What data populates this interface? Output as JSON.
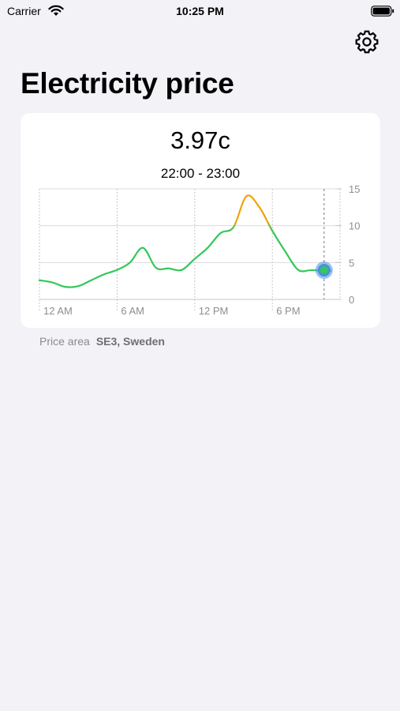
{
  "status_bar": {
    "carrier": "Carrier",
    "time": "10:25 PM",
    "icons": [
      "wifi-icon",
      "battery-icon"
    ]
  },
  "toolbar": {
    "settings_icon": "gear-icon"
  },
  "header": {
    "title": "Electricity price"
  },
  "card": {
    "price": "3.97c",
    "time_range": "22:00 - 23:00"
  },
  "footer": {
    "label": "Price area",
    "value": "SE3, Sweden"
  },
  "colors": {
    "background": "#f2f2f7",
    "low": "#34c759",
    "high": "#f0a30a",
    "selection": "#4a90e2"
  },
  "chart_data": {
    "type": "line",
    "x_unit": "hour",
    "x": [
      0,
      1,
      2,
      3,
      4,
      5,
      6,
      7,
      8,
      9,
      10,
      11,
      12,
      13,
      14,
      15,
      16,
      17,
      18,
      19,
      20,
      21,
      22,
      22.5
    ],
    "values": [
      2.6,
      2.3,
      1.7,
      1.8,
      2.6,
      3.4,
      4.0,
      5.0,
      7.0,
      4.3,
      4.2,
      4.0,
      5.5,
      7.0,
      9.0,
      9.8,
      14.0,
      12.5,
      9.3,
      6.5,
      4.0,
      3.97,
      3.9,
      3.9
    ],
    "x_tick_values": [
      0,
      6,
      12,
      18
    ],
    "x_tick_labels": [
      "12 AM",
      "6 AM",
      "12 PM",
      "6 PM"
    ],
    "y_ticks": [
      0,
      5,
      10,
      15
    ],
    "ylim": [
      0,
      15
    ],
    "xlim": [
      0,
      22.5
    ],
    "selected_x": 22,
    "selected_value": 3.97,
    "color_threshold": 10,
    "grid": true
  }
}
